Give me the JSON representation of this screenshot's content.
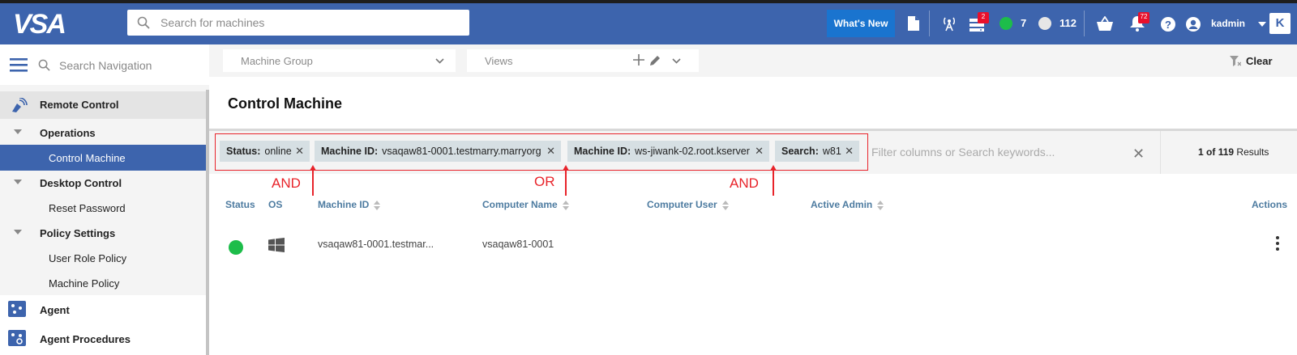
{
  "topbar": {
    "logo": "VSA",
    "search_placeholder": "Search for machines",
    "whats_new": "What's New",
    "agent_alerts_badge": "2",
    "online_count": "7",
    "offline_count": "112",
    "notifications_badge": "72",
    "username": "kadmin",
    "brand_button": "K",
    "colors": {
      "bar": "#3d64ad",
      "online": "#1dbd4a",
      "badge": "#e8102c"
    }
  },
  "nav": {
    "search_placeholder": "Search Navigation",
    "module": "Remote Control",
    "items": [
      {
        "label": "Operations"
      },
      {
        "label": "Control Machine"
      },
      {
        "label": "Desktop Control"
      },
      {
        "label": "Reset Password"
      },
      {
        "label": "Policy Settings"
      },
      {
        "label": "User Role Policy"
      },
      {
        "label": "Machine Policy"
      },
      {
        "label": "Agent"
      },
      {
        "label": "Agent Procedures"
      }
    ]
  },
  "toolbar": {
    "machine_group": "Machine Group",
    "views": "Views",
    "clear": "Clear"
  },
  "page": {
    "title": "Control Machine",
    "filters": [
      {
        "key": "Status:",
        "value": "online"
      },
      {
        "key": "Machine ID:",
        "value": "vsaqaw81-0001.testmarry.marryorg"
      },
      {
        "key": "Machine ID:",
        "value": "ws-jiwank-02.root.kserver"
      },
      {
        "key": "Search:",
        "value": "w81"
      }
    ],
    "operators": [
      "AND",
      "OR",
      "AND"
    ],
    "filter_placeholder": "Filter columns or Search keywords...",
    "results": {
      "current": "1",
      "of": "of",
      "total": "119",
      "label": "Results"
    }
  },
  "table": {
    "columns": [
      "Status",
      "OS",
      "Machine ID",
      "Computer Name",
      "Computer User",
      "Active Admin",
      "Actions"
    ],
    "rows": [
      {
        "status": "online",
        "os": "windows-icon",
        "machine_id": "vsaqaw81-0001.testmar...",
        "computer_name": "vsaqaw81-0001",
        "computer_user": "",
        "active_admin": ""
      }
    ]
  }
}
